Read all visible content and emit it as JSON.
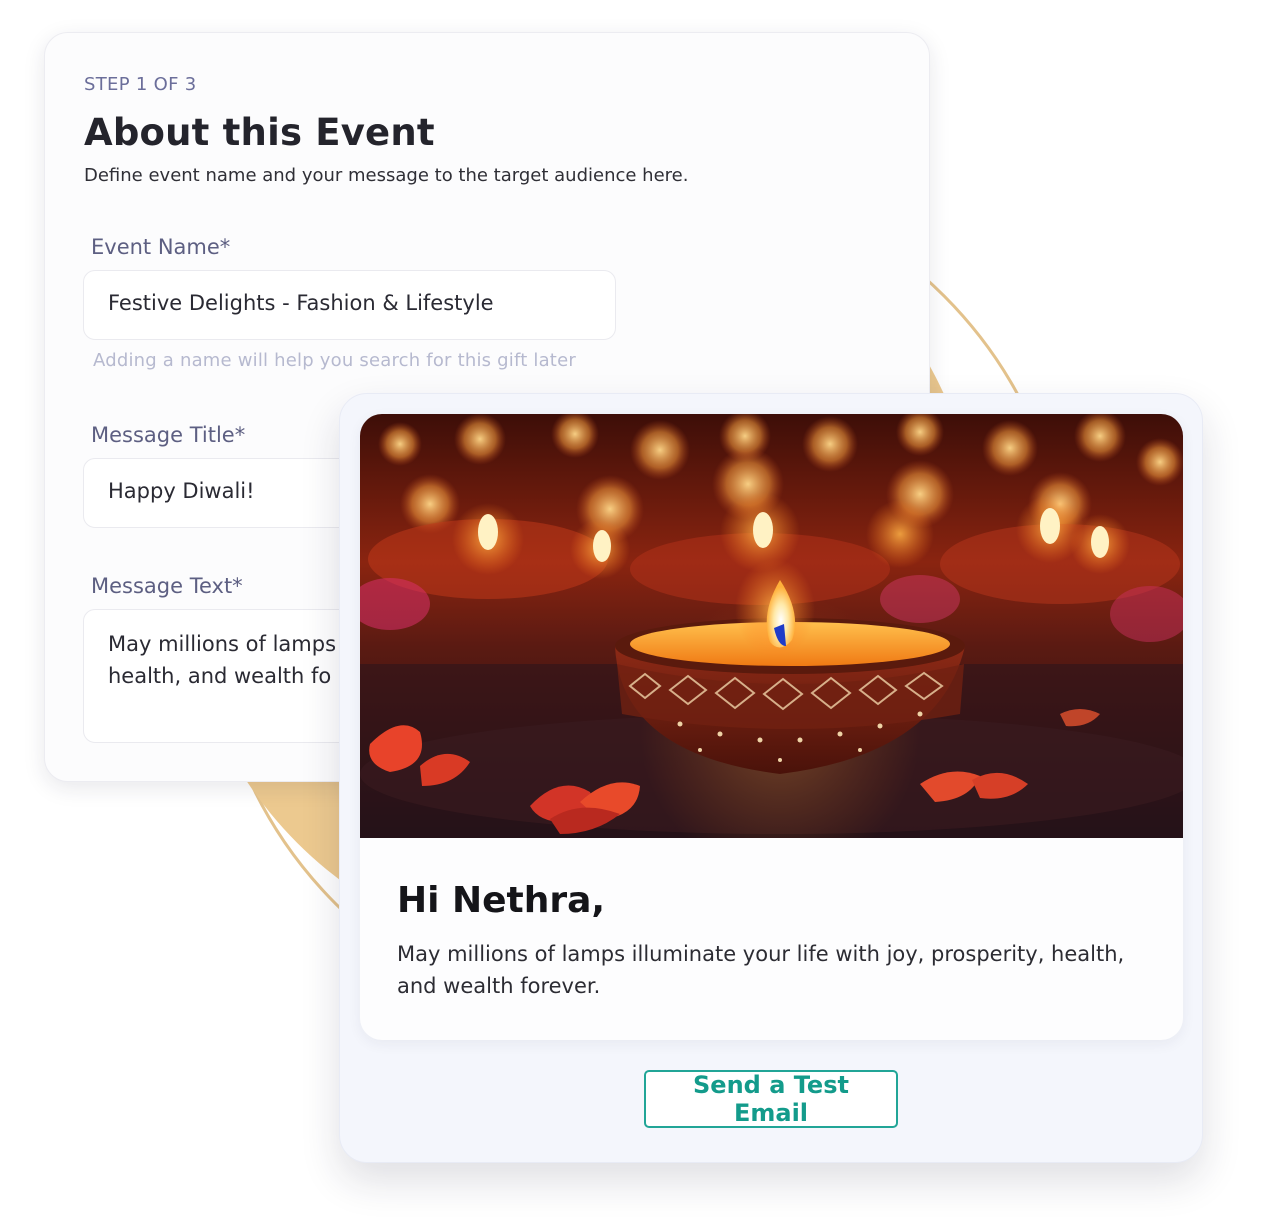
{
  "form": {
    "step": "STEP 1 OF 3",
    "title": "About this Event",
    "subtitle": "Define event name and your message to the target audience here.",
    "event_name": {
      "label": "Event Name*",
      "value": "Festive Delights - Fashion & Lifestyle",
      "hint": "Adding a name will help you search for this gift later"
    },
    "message_title": {
      "label": "Message Title*",
      "value": "Happy Diwali!"
    },
    "message_text": {
      "label": "Message Text*",
      "value_visible_lines": [
        "May millions of lamps",
        "health, and wealth fo"
      ]
    }
  },
  "preview": {
    "greeting": "Hi Nethra,",
    "message": "May millions of lamps illuminate your life with joy, prosperity, health, and wealth forever.",
    "hero_image": "diya-oil-lamp-photo",
    "send_test_button": "Send a Test Email"
  },
  "colors": {
    "accent": "#21a597",
    "decor_ring": "#e3c28c",
    "decor_disc": "#ecc98f",
    "label": "#5d5f82"
  }
}
